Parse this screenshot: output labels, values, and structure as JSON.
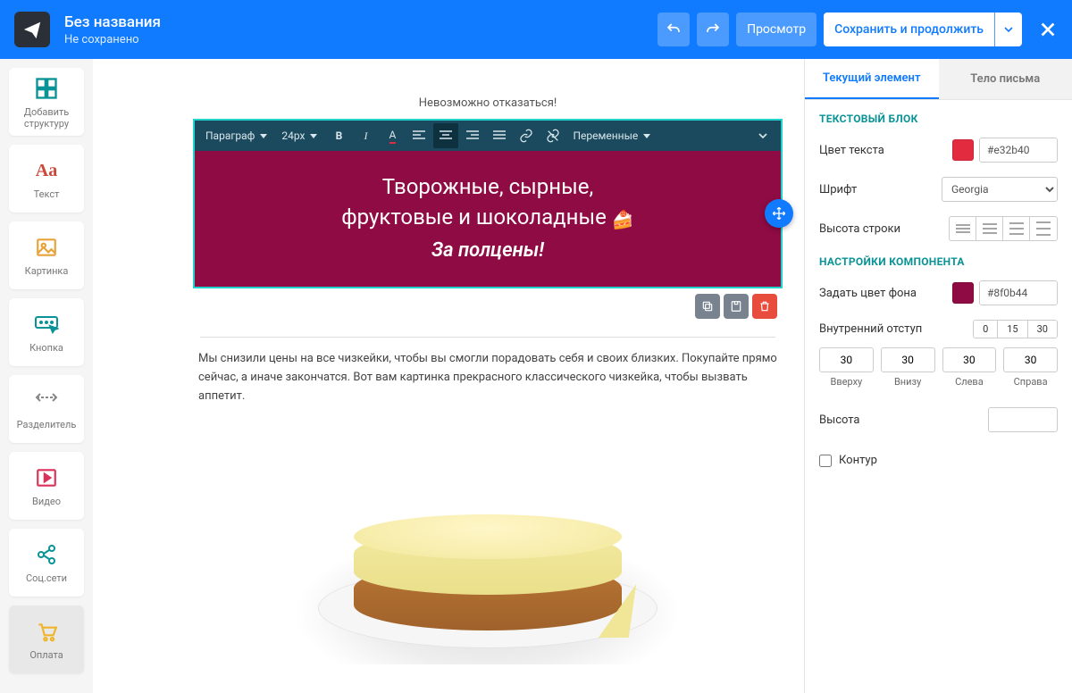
{
  "header": {
    "title": "Без названия",
    "subtitle": "Не сохранено",
    "preview": "Просмотр",
    "save": "Сохранить и продолжить"
  },
  "tools": {
    "structure": "Добавить структуру",
    "text": "Текст",
    "image": "Картинка",
    "button": "Кнопка",
    "divider": "Разделитель",
    "video": "Видео",
    "social": "Соц.сети",
    "payment": "Оплата"
  },
  "editorToolbar": {
    "paragraph": "Параграф",
    "size": "24px",
    "vars": "Переменные"
  },
  "content": {
    "teaser": "Невозможно отказаться!",
    "hero_l1": "Творожные, сырные,",
    "hero_l2": "фруктовые и шоколадные ",
    "hero_l3": "За полцены!",
    "body": "Мы снизили цены на все чизкейки, чтобы вы смогли порадовать себя и своих близких. Покупайте прямо сейчас, а иначе закончатся. Вот вам картинка прекрасного классического чизкейка, чтобы вызвать аппетит."
  },
  "rightPanel": {
    "tab1": "Текущий элемент",
    "tab2": "Тело письма",
    "sec1": "ТЕКСТОВЫЙ БЛОК",
    "textColor_lbl": "Цвет текста",
    "textColor": "#e32b40",
    "font_lbl": "Шрифт",
    "font": "Georgia",
    "lineHeight_lbl": "Высота строки",
    "sec2": "НАСТРОЙКИ КОМПОНЕНТА",
    "bg_lbl": "Задать цвет фона",
    "bg": "#8f0b44",
    "padding_lbl": "Внутренний отступ",
    "presets": [
      "0",
      "15",
      "30"
    ],
    "pad": {
      "top": "30",
      "bottom": "30",
      "left": "30",
      "right": "30",
      "top_l": "Вверху",
      "bottom_l": "Внизу",
      "left_l": "Слева",
      "right_l": "Справа"
    },
    "height_lbl": "Высота",
    "height_val": "",
    "outline_lbl": "Контур"
  }
}
